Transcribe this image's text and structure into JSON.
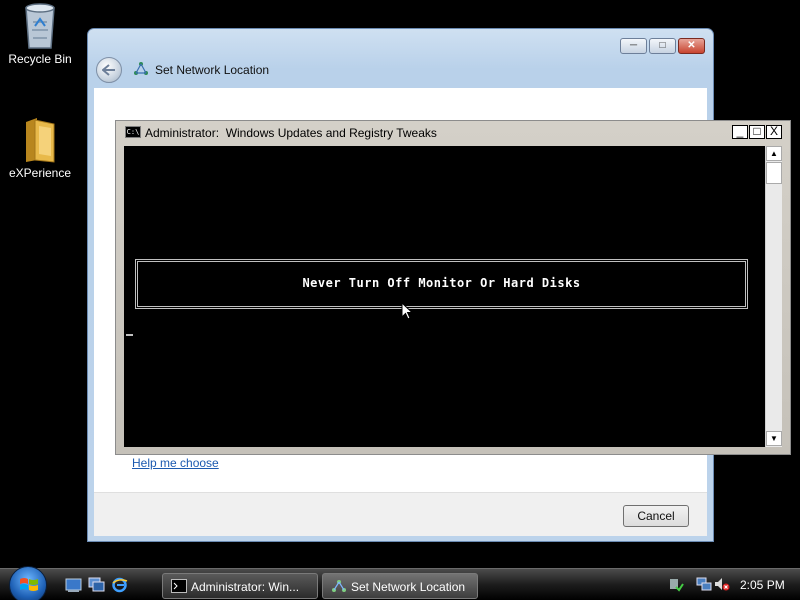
{
  "desktop": {
    "icons": [
      {
        "label": "Recycle Bin",
        "icon": "recycle-bin-icon"
      },
      {
        "label": "eXPerience",
        "icon": "folder-icon"
      }
    ]
  },
  "network_window": {
    "title": "Set Network Location",
    "help_link": "Help me choose",
    "cancel_label": "Cancel",
    "minimize_glyph": "─",
    "maximize_glyph": "□",
    "close_glyph": "✕"
  },
  "cmd_window": {
    "icon_text": "C:\\",
    "title": "Administrator:  Windows Updates and Registry Tweaks",
    "message": "Never Turn Off Monitor Or Hard Disks",
    "minimize_glyph": "_",
    "maximize_glyph": "□",
    "close_glyph": "X",
    "scroll_up": "▲",
    "scroll_down": "▼"
  },
  "taskbar": {
    "buttons": [
      {
        "label": "Administrator:  Win...",
        "icon": "console-icon"
      },
      {
        "label": "Set Network Location",
        "icon": "network-icon"
      }
    ],
    "clock": "2:05 PM"
  },
  "colors": {
    "console_bg": "#000000",
    "link": "#1c5ab0",
    "taskbar": "#1d1d1d"
  }
}
